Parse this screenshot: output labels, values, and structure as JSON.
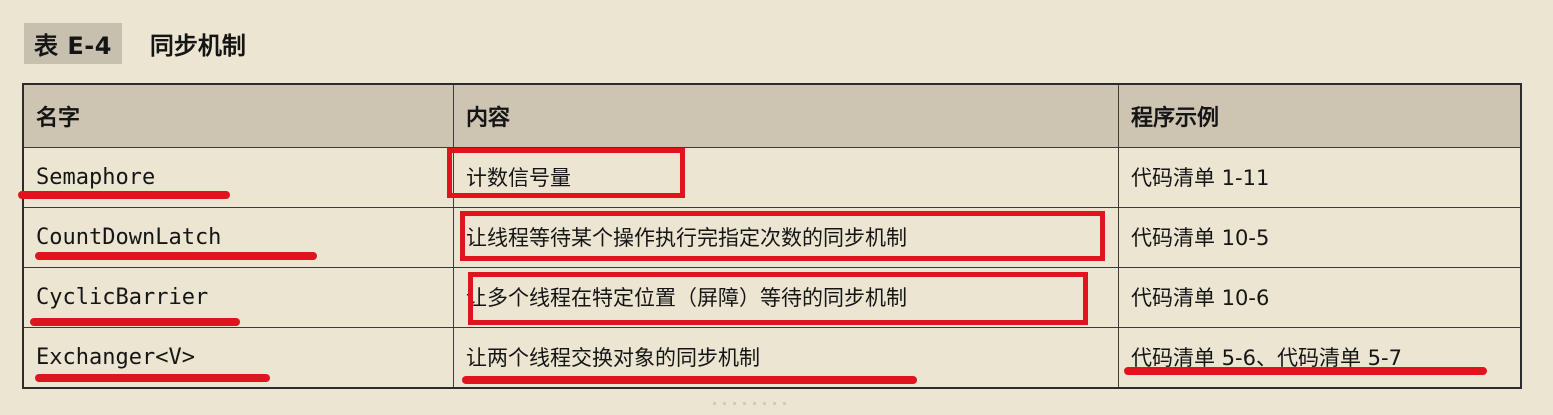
{
  "caption": {
    "label": "表 E-4",
    "title": "同步机制"
  },
  "table": {
    "headers": [
      "名字",
      "内容",
      "程序示例"
    ],
    "rows": [
      {
        "name": "Semaphore",
        "content": "计数信号量",
        "example": "代码清单 1-11"
      },
      {
        "name": "CountDownLatch",
        "content": "让线程等待某个操作执行完指定次数的同步机制",
        "example": "代码清单 10-5"
      },
      {
        "name": "CyclicBarrier",
        "content": "让多个线程在特定位置（屏障）等待的同步机制",
        "example": "代码清单 10-6"
      },
      {
        "name": "Exchanger<V>",
        "content": "让两个线程交换对象的同步机制",
        "example": "代码清单 5-6、代码清单 5-7"
      }
    ]
  },
  "colors": {
    "annotation": "#e0141f",
    "background": "#ece5d2",
    "header_background": "#cdc5b2"
  }
}
